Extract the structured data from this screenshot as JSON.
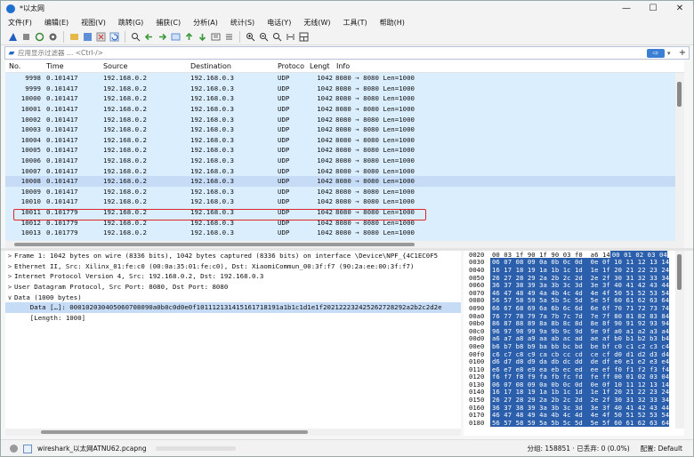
{
  "window": {
    "title": "*以太网",
    "min": "—",
    "max": "☐",
    "close": "✕"
  },
  "menu": [
    "文件(F)",
    "编辑(E)",
    "视图(V)",
    "跳转(G)",
    "捕获(C)",
    "分析(A)",
    "统计(S)",
    "电话(Y)",
    "无线(W)",
    "工具(T)",
    "帮助(H)"
  ],
  "toolbar": {
    "icons": [
      "shark-fin-icon",
      "stop-icon",
      "restart-icon",
      "options-icon",
      "open-file-icon",
      "save-icon",
      "close-file-icon",
      "reload-icon",
      "find-icon",
      "back-icon",
      "forward-icon",
      "goto-icon",
      "first-icon",
      "last-icon",
      "autoscroll-icon",
      "colorize-icon",
      "zoom-in-icon",
      "zoom-out-icon",
      "zoom-reset-icon",
      "resize-columns-icon",
      "layout-icon"
    ]
  },
  "filter": {
    "placeholder": "应用显示过滤器 … <Ctrl-/>",
    "arrow": "⇨",
    "plus": "+"
  },
  "packet_list": {
    "columns": [
      "No.",
      "Time",
      "Source",
      "Destination",
      "Protoco",
      "Lengt",
      "Info"
    ],
    "rows": [
      [
        "9998",
        "0.101417",
        "192.168.0.2",
        "192.168.0.3",
        "UDP",
        "1042",
        "8080 → 8080 Len=1000"
      ],
      [
        "9999",
        "0.101417",
        "192.168.0.2",
        "192.168.0.3",
        "UDP",
        "1042",
        "8080 → 8080 Len=1000"
      ],
      [
        "10000",
        "0.101417",
        "192.168.0.2",
        "192.168.0.3",
        "UDP",
        "1042",
        "8080 → 8080 Len=1000"
      ],
      [
        "10001",
        "0.101417",
        "192.168.0.2",
        "192.168.0.3",
        "UDP",
        "1042",
        "8080 → 8080 Len=1000"
      ],
      [
        "10002",
        "0.101417",
        "192.168.0.2",
        "192.168.0.3",
        "UDP",
        "1042",
        "8080 → 8080 Len=1000"
      ],
      [
        "10003",
        "0.101417",
        "192.168.0.2",
        "192.168.0.3",
        "UDP",
        "1042",
        "8080 → 8080 Len=1000"
      ],
      [
        "10004",
        "0.101417",
        "192.168.0.2",
        "192.168.0.3",
        "UDP",
        "1042",
        "8080 → 8080 Len=1000"
      ],
      [
        "10005",
        "0.101417",
        "192.168.0.2",
        "192.168.0.3",
        "UDP",
        "1042",
        "8080 → 8080 Len=1000"
      ],
      [
        "10006",
        "0.101417",
        "192.168.0.2",
        "192.168.0.3",
        "UDP",
        "1042",
        "8080 → 8080 Len=1000"
      ],
      [
        "10007",
        "0.101417",
        "192.168.0.2",
        "192.168.0.3",
        "UDP",
        "1042",
        "8080 → 8080 Len=1000"
      ],
      [
        "10008",
        "0.101417",
        "192.168.0.2",
        "192.168.0.3",
        "UDP",
        "1042",
        "8080 → 8080 Len=1000"
      ],
      [
        "10009",
        "0.101417",
        "192.168.0.2",
        "192.168.0.3",
        "UDP",
        "1042",
        "8080 → 8080 Len=1000"
      ],
      [
        "10010",
        "0.101417",
        "192.168.0.2",
        "192.168.0.3",
        "UDP",
        "1042",
        "8080 → 8080 Len=1000"
      ],
      [
        "10011",
        "0.101779",
        "192.168.0.2",
        "192.168.0.3",
        "UDP",
        "1042",
        "8080 → 8080 Len=1000"
      ],
      [
        "10012",
        "0.101779",
        "192.168.0.2",
        "192.168.0.3",
        "UDP",
        "1042",
        "8080 → 8080 Len=1000"
      ],
      [
        "10013",
        "0.101779",
        "192.168.0.2",
        "192.168.0.3",
        "UDP",
        "1042",
        "8080 → 8080 Len=1000"
      ],
      [
        "10014",
        "0.101779",
        "192.168.0.2",
        "192.168.0.3",
        "UDP",
        "1042",
        "8080 → 8080 Len=1000"
      ]
    ],
    "selected_row": 10
  },
  "details": [
    {
      "arrow": ">",
      "text": "Frame 1: 1042 bytes on wire (8336 bits), 1042 bytes captured (8336 bits) on interface \\Device\\NPF_{4C1EC0F5",
      "sel": false
    },
    {
      "arrow": ">",
      "text": "Ethernet II, Src: Xilinx_01:fe:c0 (00:0a:35:01:fe:c0), Dst: XiaomiCommun_00:3f:f7 (90:2a:ee:00:3f:f7)",
      "sel": false
    },
    {
      "arrow": ">",
      "text": "Internet Protocol Version 4, Src: 192.168.0.2, Dst: 192.168.0.3",
      "sel": false
    },
    {
      "arrow": ">",
      "text": "User Datagram Protocol, Src Port: 8080, Dst Port: 8080",
      "sel": false
    },
    {
      "arrow": "∨",
      "text": "Data (1000 bytes)",
      "sel": false
    },
    {
      "arrow": "",
      "text": "    Data […]: 000102030405060708090a0b0c0d0e0f101112131415161718191a1b1c1d1e1f202122232425262728292a2b2c2d2e",
      "sel": true
    },
    {
      "arrow": "",
      "text": "    [Length: 1000]",
      "sel": false
    }
  ],
  "hex": [
    [
      "0020",
      "00 03 1f 90 1f 90 03 f0  a6 14",
      "00 01 02 03 04"
    ],
    [
      "0030",
      "",
      "06 07 08 09 0a 0b 0c 0d  0e 0f 10 11 12 13 14"
    ],
    [
      "0040",
      "",
      "16 17 18 19 1a 1b 1c 1d  1e 1f 20 21 22 23 24"
    ],
    [
      "0050",
      "",
      "26 27 28 29 2a 2b 2c 2d  2e 2f 30 31 32 33 34"
    ],
    [
      "0060",
      "",
      "36 37 38 39 3a 3b 3c 3d  3e 3f 40 41 42 43 44"
    ],
    [
      "0070",
      "",
      "46 47 48 49 4a 4b 4c 4d  4e 4f 50 51 52 53 54"
    ],
    [
      "0080",
      "",
      "56 57 58 59 5a 5b 5c 5d  5e 5f 60 61 62 63 64"
    ],
    [
      "0090",
      "",
      "66 67 68 69 6a 6b 6c 6d  6e 6f 70 71 72 73 74"
    ],
    [
      "00a0",
      "",
      "76 77 78 79 7a 7b 7c 7d  7e 7f 80 81 82 83 84"
    ],
    [
      "00b0",
      "",
      "86 87 88 89 8a 8b 8c 8d  8e 8f 90 91 92 93 94"
    ],
    [
      "00c0",
      "",
      "96 97 98 99 9a 9b 9c 9d  9e 9f a0 a1 a2 a3 a4"
    ],
    [
      "00d0",
      "",
      "a6 a7 a8 a9 aa ab ac ad  ae af b0 b1 b2 b3 b4"
    ],
    [
      "00e0",
      "",
      "b6 b7 b8 b9 ba bb bc bd  be bf c0 c1 c2 c3 c4"
    ],
    [
      "00f0",
      "",
      "c6 c7 c8 c9 ca cb cc cd  ce cf d0 d1 d2 d3 d4"
    ],
    [
      "0100",
      "",
      "d6 d7 d8 d9 da db dc dd  de df e0 e1 e2 e3 e4"
    ],
    [
      "0110",
      "",
      "e6 e7 e8 e9 ea eb ec ed  ee ef f0 f1 f2 f3 f4"
    ],
    [
      "0120",
      "",
      "f6 f7 f8 f9 fa fb fc fd  fe ff 00 01 02 03 04"
    ],
    [
      "0130",
      "",
      "06 07 08 09 0a 0b 0c 0d  0e 0f 10 11 12 13 14"
    ],
    [
      "0140",
      "",
      "16 17 18 19 1a 1b 1c 1d  1e 1f 20 21 22 23 24"
    ],
    [
      "0150",
      "",
      "26 27 28 29 2a 2b 2c 2d  2e 2f 30 31 32 33 34"
    ],
    [
      "0160",
      "",
      "36 37 38 39 3a 3b 3c 3d  3e 3f 40 41 42 43 44"
    ],
    [
      "0170",
      "",
      "46 47 48 49 4a 4b 4c 4d  4e 4f 50 51 52 53 54"
    ],
    [
      "0180",
      "",
      "56 57 58 59 5a 5b 5c 5d  5e 5f 60 61 62 63 64"
    ]
  ],
  "status": {
    "file": "wireshark_以太网ATNU62.pcapng",
    "stats": "分组: 158851 · 已丢弃: 0 (0.0%)",
    "profile": "配置: Default"
  }
}
